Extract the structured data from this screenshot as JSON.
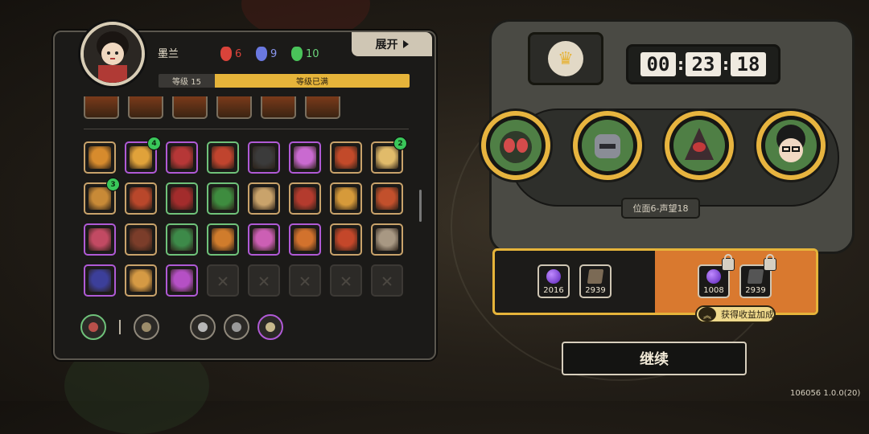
{
  "character": {
    "name": "墨兰",
    "resources": [
      {
        "icon": "red-mask-icon",
        "value": "6",
        "color": "#d9433a"
      },
      {
        "icon": "blue-mask-icon",
        "value": "9",
        "color": "#6a78e0"
      },
      {
        "icon": "green-mask-icon",
        "value": "10",
        "color": "#4ac35a"
      }
    ],
    "level_label": "等级 15",
    "level_status": "等级已满",
    "level_progress": 1.0
  },
  "expand_button": "展开",
  "skill_grid": [
    {
      "color": "#d78b2d",
      "border": "#c9a36b"
    },
    {
      "color": "#e0a23a",
      "border": "#b05ad6",
      "badge": "4"
    },
    {
      "color": "#b63737",
      "border": "#b05ad6"
    },
    {
      "color": "#c0442e",
      "border": "#6fc27a"
    },
    {
      "color": "#3b3b3b",
      "border": "#b05ad6"
    },
    {
      "color": "#c96ad0",
      "border": "#b05ad6"
    },
    {
      "color": "#c24a2a",
      "border": "#c9a36b"
    },
    {
      "color": "#e1bb6a",
      "border": "#c9a36b",
      "badge": "2"
    },
    {
      "color": "#c88a37",
      "border": "#c9a36b",
      "badge": "3"
    },
    {
      "color": "#b9472b",
      "border": "#c9a36b"
    },
    {
      "color": "#a32c2c",
      "border": "#6fc27a"
    },
    {
      "color": "#3e8c3f",
      "border": "#6fc27a"
    },
    {
      "color": "#c9a36b",
      "border": "#c9a36b"
    },
    {
      "color": "#b43b2e",
      "border": "#c9a36b"
    },
    {
      "color": "#d69a3a",
      "border": "#c9a36b"
    },
    {
      "color": "#c2502c",
      "border": "#c9a36b"
    },
    {
      "color": "#c24a63",
      "border": "#b05ad6"
    },
    {
      "color": "#7b3d2a",
      "border": "#c9a36b"
    },
    {
      "color": "#3d8a49",
      "border": "#6fc27a"
    },
    {
      "color": "#d07c2c",
      "border": "#6fc27a"
    },
    {
      "color": "#cc5fb4",
      "border": "#b05ad6"
    },
    {
      "color": "#d2722d",
      "border": "#b05ad6"
    },
    {
      "color": "#c4472a",
      "border": "#c9a36b"
    },
    {
      "color": "#a89883",
      "border": "#c9a36b"
    },
    {
      "color": "#3c3f9a",
      "border": "#b05ad6"
    },
    {
      "color": "#d59a44",
      "border": "#c9a36b"
    },
    {
      "color": "#b550c5",
      "border": "#b05ad6"
    },
    {
      "empty": true
    },
    {
      "empty": true
    },
    {
      "empty": true
    },
    {
      "empty": true
    },
    {
      "empty": true
    }
  ],
  "bottom_slots": [
    {
      "name": "relic-slot-1",
      "color": "#b8504a",
      "border": "#6fc27a"
    },
    {
      "name": "relic-slot-2",
      "color": "#9c8c6a",
      "border": "#8f887b"
    },
    {
      "name": "relic-slot-3",
      "color": "#b7b7b7",
      "border": "#8f887b"
    },
    {
      "name": "relic-slot-4",
      "color": "#9a9a9a",
      "border": "#8f887b"
    },
    {
      "name": "relic-slot-5",
      "color": "#c7b98c",
      "border": "#b05ad6"
    }
  ],
  "timer": {
    "hh": "00",
    "mm": "23",
    "ss": "18"
  },
  "party": [
    {
      "name": "party-slot-1",
      "bg": "#4e8a49"
    },
    {
      "name": "party-slot-2",
      "bg": "#557d47"
    },
    {
      "name": "party-slot-3",
      "bg": "#4f8647"
    },
    {
      "name": "party-slot-4",
      "bg": "#5c8c4f"
    }
  ],
  "position_label": "位面6-声望18",
  "rewards": {
    "base": [
      {
        "icon": "purple-orb-icon",
        "value": "2016",
        "color": "#7c3fd0"
      },
      {
        "icon": "book-icon",
        "value": "2939",
        "color": "#7b6a55"
      }
    ],
    "locked": [
      {
        "icon": "purple-orb-icon",
        "value": "1008",
        "color": "#7c3fd0"
      },
      {
        "icon": "book-icon",
        "value": "2939",
        "color": "#555"
      }
    ],
    "bonus_label": "获得收益加成"
  },
  "continue_button": "继续",
  "version": "106056 1.0.0(20)"
}
